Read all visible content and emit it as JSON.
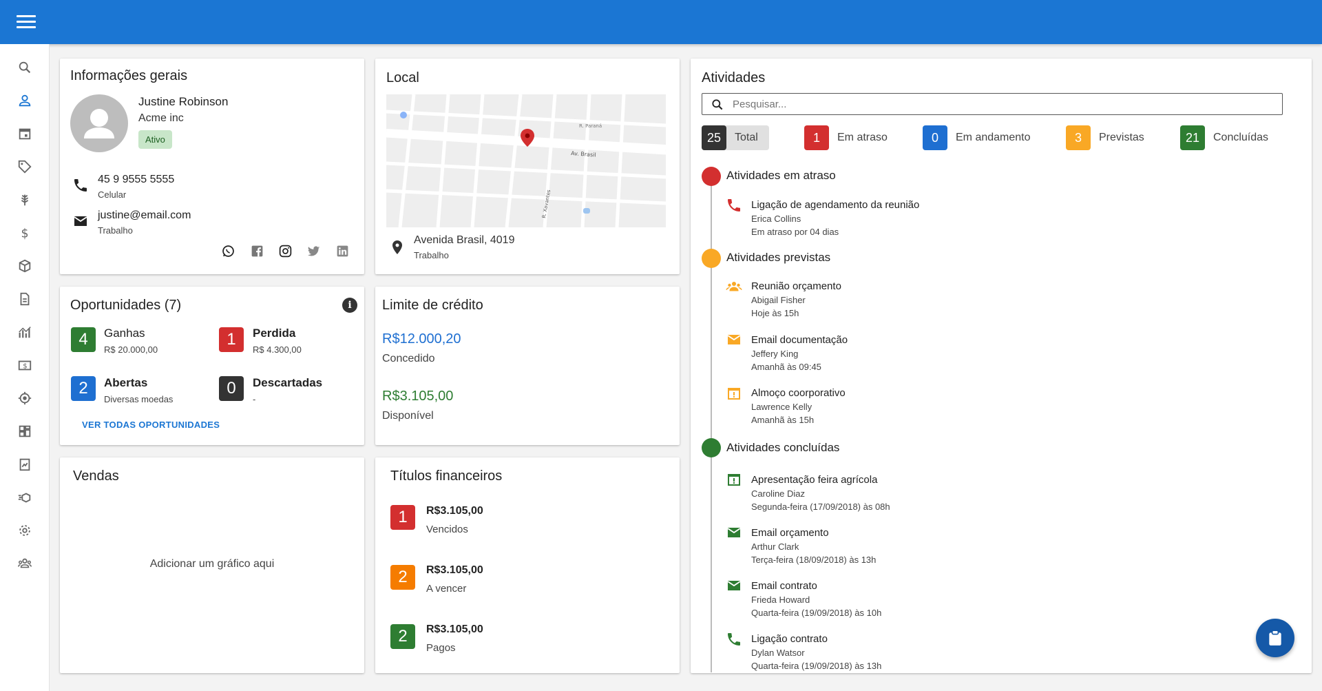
{
  "colors": {
    "primary": "#1b76d3",
    "red": "#d32f2f",
    "green": "#2e7d32",
    "blue": "#1e6fd1",
    "orange": "#f9a825",
    "dark": "#333333",
    "deep_orange": "#f57c00"
  },
  "sidebar": {
    "icons": [
      "search-icon",
      "person-icon",
      "calendar-icon",
      "tag-icon",
      "grain-icon",
      "dollar-icon",
      "box-icon",
      "document-icon",
      "chart-icon",
      "money-icon",
      "target-icon",
      "dashboard-icon",
      "report-icon",
      "delivery-icon",
      "settings-icon",
      "team-icon"
    ]
  },
  "general": {
    "title": "Informações gerais",
    "name": "Justine Robinson",
    "company": "Acme inc",
    "status": "Ativo",
    "phone": "45 9 9555 5555",
    "phone_type": "Celular",
    "email": "justine@email.com",
    "email_type": "Trabalho",
    "socials": [
      "whatsapp-icon",
      "facebook-icon",
      "instagram-icon",
      "twitter-icon",
      "linkedin-icon"
    ]
  },
  "local": {
    "title": "Local",
    "address": "Avenida Brasil, 4019",
    "address_type": "Trabalho",
    "map_labels": [
      "Av. Brasil",
      "R. Xavantes",
      "R. Paraná"
    ]
  },
  "opportunities": {
    "title": "Oportunidades (7)",
    "items": [
      {
        "count": "4",
        "label": "Ganhas",
        "sub": "R$ 20.000,00"
      },
      {
        "count": "1",
        "label": "Perdida",
        "sub": "R$ 4.300,00"
      },
      {
        "count": "2",
        "label": "Abertas",
        "sub": "Diversas moedas"
      },
      {
        "count": "0",
        "label": "Descartadas",
        "sub": "-"
      }
    ],
    "link": "VER TODAS OPORTUNIDADES"
  },
  "credit": {
    "title": "Limite de crédito",
    "granted_value": "R$12.000,20",
    "granted_label": "Concedido",
    "available_value": "R$3.105,00",
    "available_label": "Disponível"
  },
  "sales": {
    "title": "Vendas",
    "placeholder": "Adicionar um gráfico aqui"
  },
  "titles": {
    "title": "Títulos financeiros",
    "items": [
      {
        "count": "1",
        "value": "R$3.105,00",
        "label": "Vencidos"
      },
      {
        "count": "2",
        "value": "R$3.105,00",
        "label": "A vencer"
      },
      {
        "count": "2",
        "value": "R$3.105,00",
        "label": "Pagos"
      }
    ]
  },
  "activities": {
    "title": "Atividades",
    "search_placeholder": "Pesquisar...",
    "filters": [
      {
        "count": "25",
        "label": "Total"
      },
      {
        "count": "1",
        "label": "Em atraso"
      },
      {
        "count": "0",
        "label": "Em andamento"
      },
      {
        "count": "3",
        "label": "Previstas"
      },
      {
        "count": "21",
        "label": "Concluídas"
      }
    ],
    "groups": [
      {
        "title": "Atividades em atraso",
        "items": [
          {
            "title": "Ligação de agendamento da reunião",
            "person": "Erica Collins",
            "when": "Em atraso por 04 dias"
          }
        ]
      },
      {
        "title": "Atividades previstas",
        "items": [
          {
            "title": "Reunião orçamento",
            "person": "Abigail Fisher",
            "when": "Hoje às 15h"
          },
          {
            "title": "Email documentação",
            "person": "Jeffery King",
            "when": "Amanhã às 09:45"
          },
          {
            "title": "Almoço coorporativo",
            "person": "Lawrence Kelly",
            "when": "Amanhã às 15h"
          }
        ]
      },
      {
        "title": "Atividades concluídas",
        "items": [
          {
            "title": "Apresentação feira agrícola",
            "person": "Caroline Diaz",
            "when": "Segunda-feira (17/09/2018) às 08h"
          },
          {
            "title": "Email orçamento",
            "person": "Arthur Clark",
            "when": "Terça-feira (18/09/2018) às 13h"
          },
          {
            "title": "Email contrato",
            "person": "Frieda Howard",
            "when": "Quarta-feira (19/09/2018) às 10h"
          },
          {
            "title": "Ligação contrato",
            "person": "Dylan Watsor",
            "when": "Quarta-feira (19/09/2018) às 13h"
          }
        ]
      }
    ]
  }
}
